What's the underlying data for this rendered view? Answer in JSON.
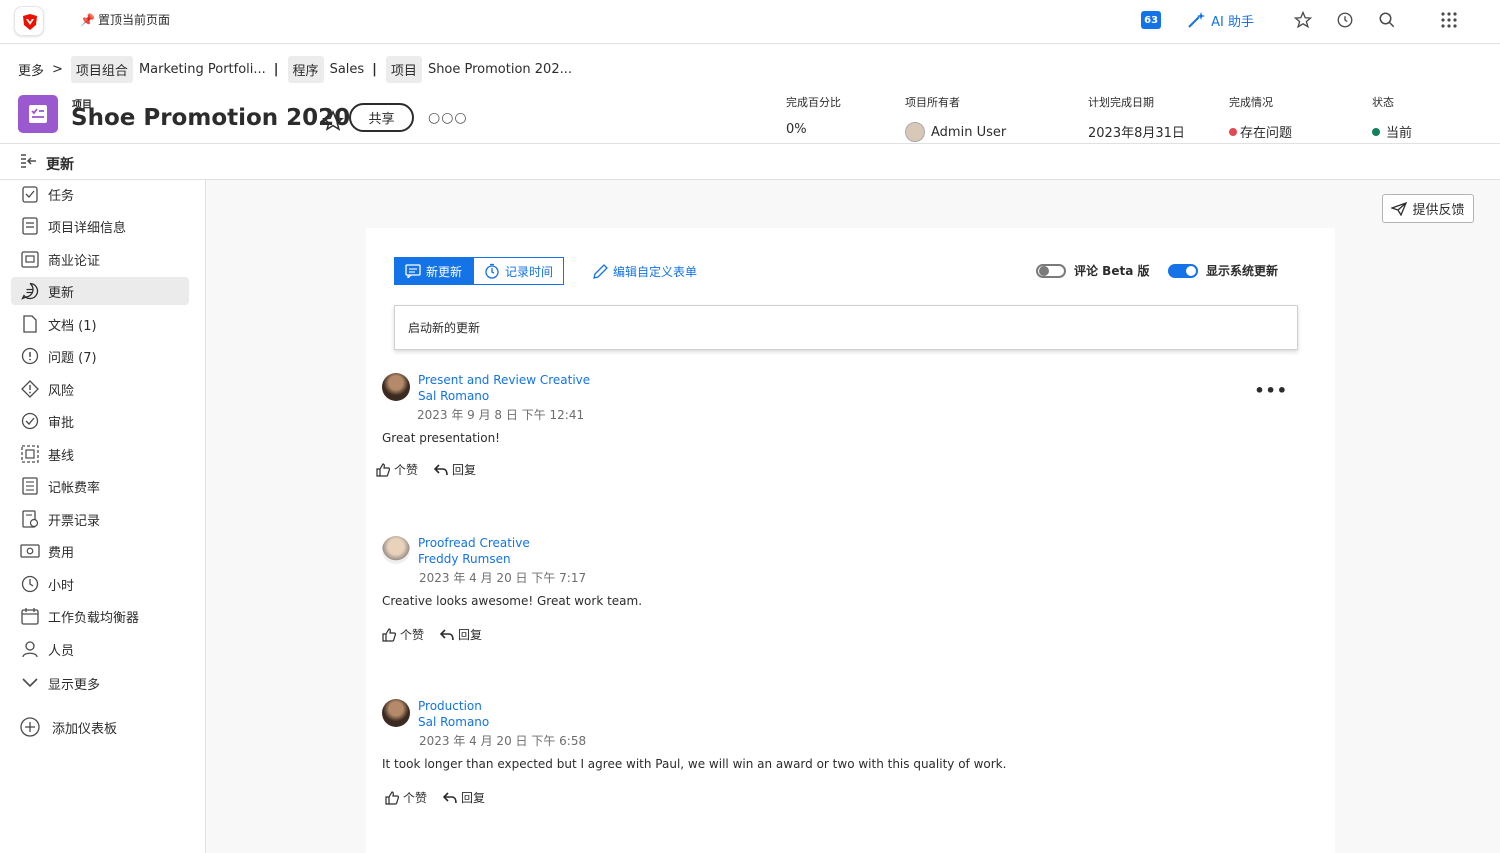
{
  "topbar": {
    "pin_label": "置顶当前页面",
    "badge_count": "63",
    "ai_label": "AI 助手"
  },
  "breadcrumb": {
    "more": "更多",
    "chevron": ">",
    "portfolio_chip": "项目组合",
    "portfolio": "Marketing Portfoli...",
    "program_chip": "程序",
    "program": "Sales",
    "project_chip": "项目",
    "project": "Shoe Promotion 202...",
    "separator": "|"
  },
  "project": {
    "type_label": "项目",
    "title": "Shoe Promotion 2020",
    "share_label": "共享",
    "more": "○○○"
  },
  "meta": {
    "percent_label": "完成百分比",
    "percent_value": "0%",
    "owner_label": "项目所有者",
    "owner_value": "Admin User",
    "planned_label": "计划完成日期",
    "planned_value": "2023年8月31日",
    "condition_label": "完成情况",
    "condition_value": "存在问题",
    "condition_color": "#e34850",
    "status_label": "状态",
    "status_value": "当前",
    "status_color": "#12805c"
  },
  "subbar": {
    "title": "更新"
  },
  "sidebar": {
    "items": [
      {
        "label": "任务",
        "icon": "task-icon"
      },
      {
        "label": "项目详细信息",
        "icon": "details-icon"
      },
      {
        "label": "商业论证",
        "icon": "business-case-icon"
      },
      {
        "label": "更新",
        "icon": "updates-icon"
      },
      {
        "label": "文档 (1)",
        "icon": "document-icon"
      },
      {
        "label": "问题 (7)",
        "icon": "issue-icon"
      },
      {
        "label": "风险",
        "icon": "risk-icon"
      },
      {
        "label": "审批",
        "icon": "approval-icon"
      },
      {
        "label": "基线",
        "icon": "baseline-icon"
      },
      {
        "label": "记帐费率",
        "icon": "billing-rate-icon"
      },
      {
        "label": "开票记录",
        "icon": "invoice-icon"
      },
      {
        "label": "费用",
        "icon": "expense-icon"
      },
      {
        "label": "小时",
        "icon": "clock-icon"
      },
      {
        "label": "工作负载均衡器",
        "icon": "workload-icon"
      },
      {
        "label": "人员",
        "icon": "people-icon"
      }
    ],
    "show_more": "显示更多",
    "add_dashboard": "添加仪表板"
  },
  "feedback_label": "提供反馈",
  "updates": {
    "tab_new": "新更新",
    "tab_log": "记录时间",
    "edit_form": "编辑自定义表单",
    "comment_beta": "评论 Beta 版",
    "show_system": "显示系统更新",
    "placeholder": "启动新的更新",
    "accent": "#1473e6"
  },
  "posts": [
    {
      "subject": "Present and Review Creative",
      "author": "Sal Romano",
      "date": "2023 年 9 月 8 日 下午 12:41",
      "body": "Great presentation!",
      "like": "个赞",
      "reply": "回复"
    },
    {
      "subject": "Proofread Creative",
      "author": "Freddy Rumsen",
      "date": "2023 年 4 月 20 日 下午 7:17",
      "body": "Creative looks awesome! Great work team.",
      "like": "个赞",
      "reply": "回复"
    },
    {
      "subject": "Production",
      "author": "Sal Romano",
      "date": "2023 年 4 月 20 日 下午 6:58",
      "body": "It took longer than expected but I agree with Paul, we will win an award or two with this quality of work.",
      "like": "个赞",
      "reply": "回复"
    }
  ],
  "post_more": "•••"
}
